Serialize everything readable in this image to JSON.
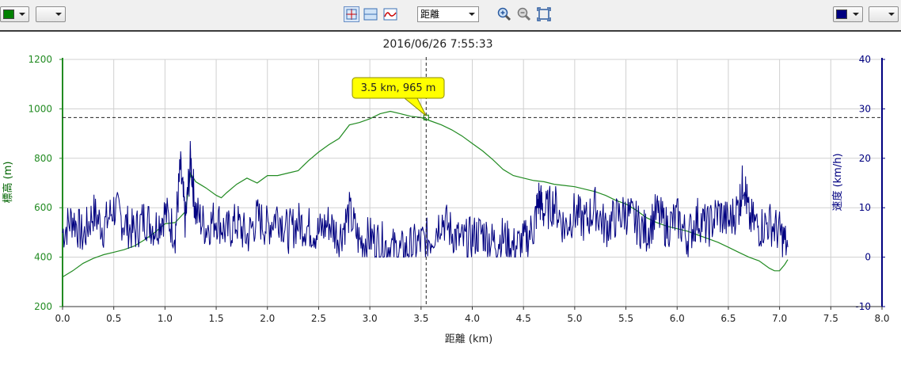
{
  "toolbar": {
    "left_color": "#008000",
    "right_color": "#000080",
    "x_axis_select": "距離",
    "icons": [
      "crosshair-icon",
      "horizontal-split-icon",
      "line-chart-icon",
      "zoom-in-icon",
      "zoom-out-icon",
      "fit-icon"
    ]
  },
  "chart_data": {
    "type": "line",
    "title": "2016/06/26 7:55:33",
    "xlabel": "距離 (km)",
    "ylabel_left": "標高 (m)",
    "ylabel_right": "速度 (km/h)",
    "xlim": [
      0,
      8
    ],
    "ylim_left": [
      200,
      1200
    ],
    "ylim_right": [
      -10,
      40
    ],
    "x_ticks": [
      "0.0",
      "0.5",
      "1.0",
      "1.5",
      "2.0",
      "2.5",
      "3.0",
      "3.5",
      "4.0",
      "4.5",
      "5.0",
      "5.5",
      "6.0",
      "6.5",
      "7.0",
      "7.5",
      "8.0"
    ],
    "y_left_ticks": [
      "200",
      "400",
      "600",
      "800",
      "1000",
      "1200"
    ],
    "y_right_ticks": [
      "-10",
      "0",
      "10",
      "20",
      "30",
      "40"
    ],
    "grid": true,
    "cursor": {
      "x": 3.55,
      "y": 965,
      "label": "3.5 km, 965 m"
    },
    "series": [
      {
        "axis": "left",
        "color": "#228b22",
        "x": [
          0.0,
          0.1,
          0.2,
          0.3,
          0.4,
          0.5,
          0.6,
          0.7,
          0.8,
          0.9,
          1.0,
          1.1,
          1.2,
          1.25,
          1.3,
          1.4,
          1.5,
          1.55,
          1.6,
          1.7,
          1.8,
          1.9,
          2.0,
          2.1,
          2.2,
          2.3,
          2.4,
          2.5,
          2.6,
          2.7,
          2.8,
          2.9,
          3.0,
          3.1,
          3.2,
          3.3,
          3.4,
          3.5,
          3.6,
          3.7,
          3.8,
          3.9,
          4.0,
          4.1,
          4.2,
          4.3,
          4.4,
          4.5,
          4.6,
          4.7,
          4.8,
          4.9,
          5.0,
          5.1,
          5.2,
          5.3,
          5.4,
          5.5,
          5.6,
          5.7,
          5.8,
          5.9,
          6.0,
          6.1,
          6.2,
          6.3,
          6.4,
          6.5,
          6.6,
          6.7,
          6.8,
          6.9,
          6.95,
          7.0,
          7.05,
          7.08
        ],
        "values": [
          320,
          345,
          375,
          395,
          410,
          420,
          430,
          445,
          470,
          500,
          535,
          540,
          585,
          740,
          705,
          680,
          650,
          640,
          660,
          695,
          720,
          700,
          730,
          730,
          740,
          750,
          790,
          825,
          855,
          880,
          935,
          945,
          960,
          980,
          990,
          980,
          970,
          965,
          950,
          935,
          915,
          890,
          860,
          830,
          795,
          755,
          730,
          720,
          710,
          705,
          695,
          690,
          685,
          675,
          665,
          650,
          630,
          615,
          590,
          560,
          540,
          525,
          515,
          505,
          490,
          475,
          460,
          440,
          420,
          400,
          385,
          355,
          345,
          345,
          370,
          390
        ]
      },
      {
        "axis": "right",
        "color": "#000080",
        "x": [
          0.0,
          0.1,
          0.2,
          0.3,
          0.4,
          0.5,
          0.6,
          0.7,
          0.8,
          0.9,
          1.0,
          1.1,
          1.15,
          1.2,
          1.25,
          1.3,
          1.4,
          1.5,
          1.6,
          1.7,
          1.8,
          1.9,
          2.0,
          2.1,
          2.2,
          2.3,
          2.4,
          2.5,
          2.6,
          2.7,
          2.8,
          2.9,
          3.0,
          3.1,
          3.2,
          3.3,
          3.4,
          3.5,
          3.6,
          3.7,
          3.8,
          3.9,
          4.0,
          4.1,
          4.2,
          4.3,
          4.4,
          4.5,
          4.6,
          4.65,
          4.7,
          4.8,
          4.9,
          5.0,
          5.1,
          5.2,
          5.3,
          5.4,
          5.5,
          5.6,
          5.7,
          5.8,
          5.9,
          6.0,
          6.1,
          6.2,
          6.3,
          6.4,
          6.5,
          6.6,
          6.65,
          6.7,
          6.8,
          6.9,
          7.0,
          7.08
        ],
        "values": [
          5,
          8,
          4,
          9,
          6,
          10,
          7,
          5,
          8,
          6,
          9,
          5,
          18,
          7,
          20,
          9,
          6,
          8,
          5,
          7,
          4,
          8,
          6,
          9,
          5,
          7,
          6,
          5,
          7,
          4,
          9,
          3,
          4,
          3,
          2,
          1,
          2,
          3,
          4,
          8,
          5,
          3,
          4,
          5,
          3,
          4,
          2,
          3,
          6,
          12,
          9,
          11,
          6,
          9,
          7,
          10,
          6,
          8,
          9,
          7,
          5,
          9,
          6,
          8,
          4,
          8,
          6,
          9,
          7,
          10,
          16,
          8,
          6,
          7,
          5,
          2
        ]
      }
    ]
  }
}
